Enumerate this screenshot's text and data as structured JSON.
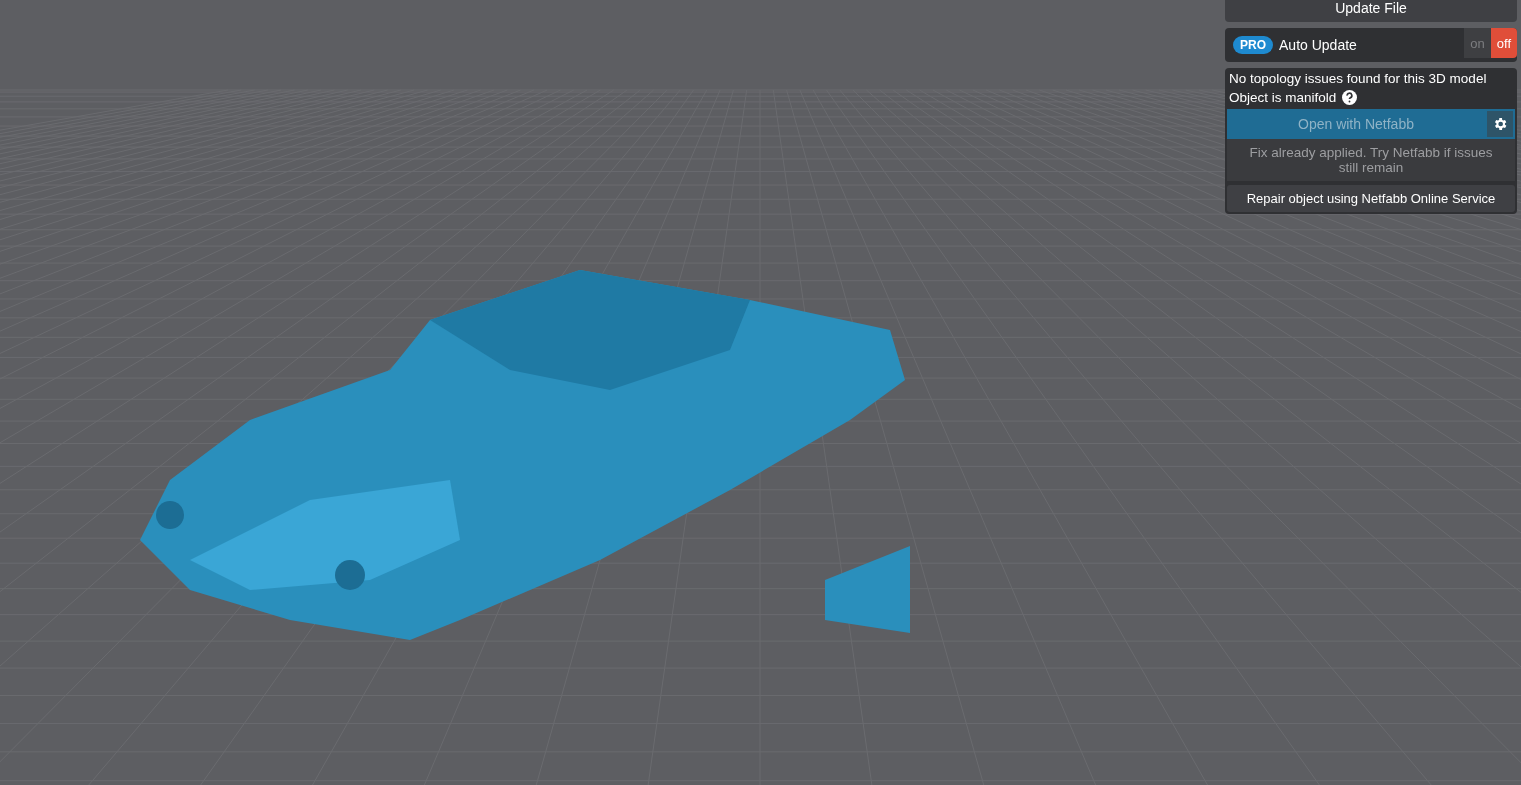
{
  "panel": {
    "update_button": {
      "label": "Update File"
    },
    "auto_update": {
      "badge": "PRO",
      "label": "Auto Update",
      "options": [
        {
          "label": "on",
          "selected": false
        },
        {
          "label": "off",
          "selected": true
        }
      ]
    },
    "status": {
      "message": "No topology issues found for this 3D model",
      "manifold": "Object is manifold"
    },
    "netfabb_button": {
      "label": "Open with Netfabb",
      "disabled": true
    },
    "note": "Fix already applied. Try Netfabb if issues still remain",
    "repair_button": {
      "label": "Repair object using Netfabb Online Service"
    }
  }
}
